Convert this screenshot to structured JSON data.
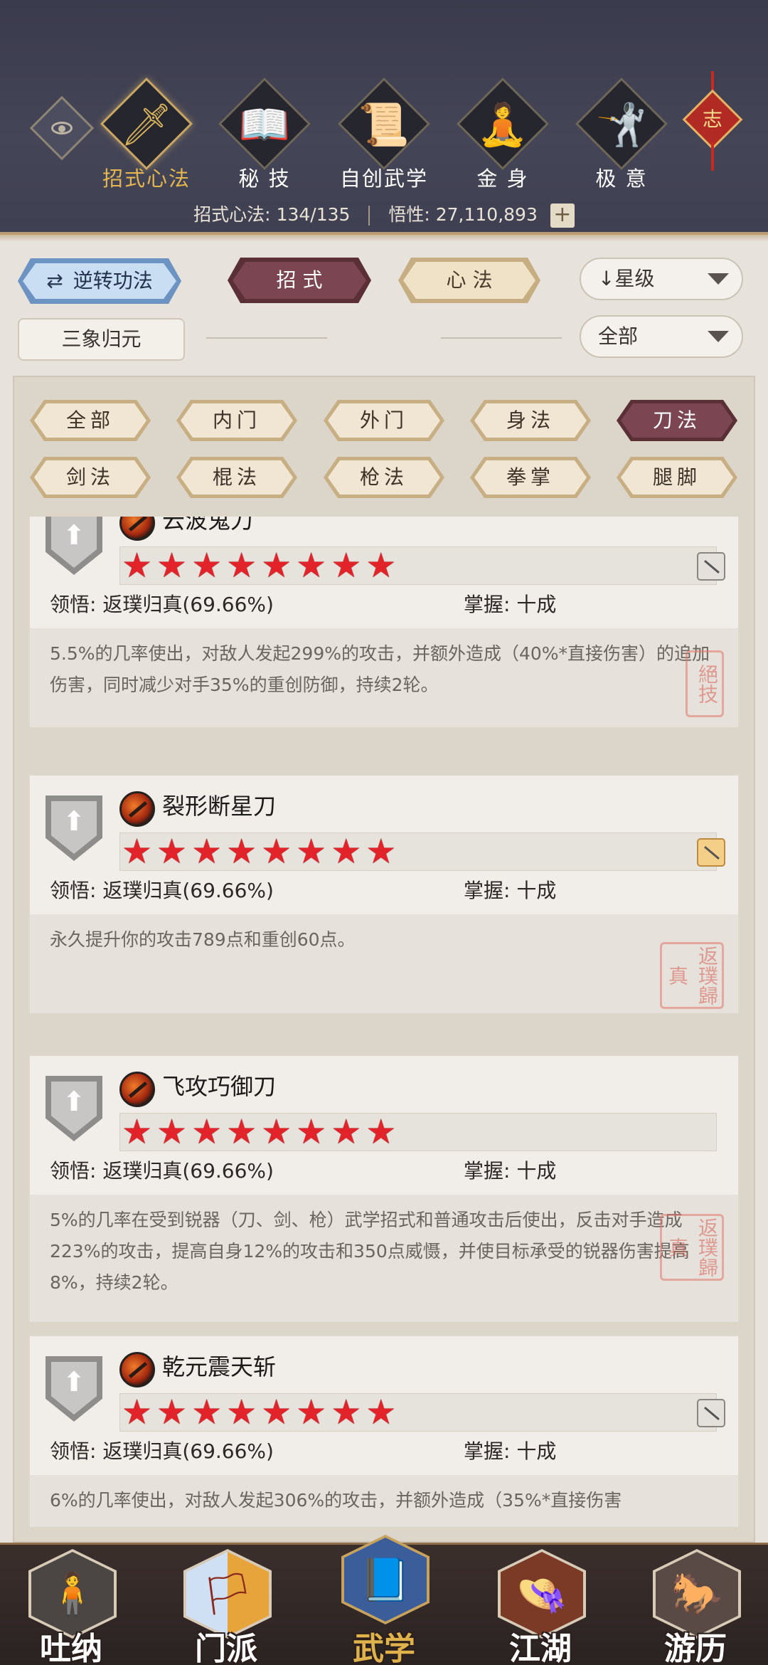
{
  "header": {
    "tabs": [
      {
        "label": "招式心法",
        "icon": "sword-icon",
        "glyph": "🗡"
      },
      {
        "label": "秘 技",
        "icon": "book-icon",
        "glyph": "📖"
      },
      {
        "label": "自创武学",
        "icon": "scroll-icon",
        "glyph": "📜"
      },
      {
        "label": "金 身",
        "icon": "meditation-icon",
        "glyph": "🧘"
      },
      {
        "label": "极 意",
        "icon": "martial-stance-icon",
        "glyph": "🤺"
      }
    ],
    "knot_char": "志",
    "stats": {
      "skills_label": "招式心法:",
      "skills_value": "134/135",
      "insight_label": "悟性:",
      "insight_value": "27,110,893",
      "plus": "+"
    }
  },
  "controls": {
    "reverse_label": "逆转功法",
    "reverse_icon": "⇄",
    "tab_zhaoshi": "招 式",
    "tab_xinfa": "心 法",
    "sort_label": "↓星级",
    "filter_label": "全部",
    "sanxiang_label": "三象归元"
  },
  "categories": [
    "全部",
    "内门",
    "外门",
    "身法",
    "刀法",
    "剑法",
    "棍法",
    "枪法",
    "拳掌",
    "腿脚"
  ],
  "cards": [
    {
      "name": "云波鬼刀",
      "stars": "★★★★★★★★",
      "comprehension_label": "领悟:",
      "comprehension_value": "返璞归真(69.66%)",
      "mastery_label": "掌握:",
      "mastery_value": "十成",
      "desc": "5.5%的几率使出，对敌人发起299%的攻击，并额外造成（40%*直接伤害）的追加伤害，同时减少对手35%的重创防御，持续2轮。",
      "seal": "絕技"
    },
    {
      "name": "裂形断星刀",
      "stars": "★★★★★★★★",
      "comprehension_label": "领悟:",
      "comprehension_value": "返璞归真(69.66%)",
      "mastery_label": "掌握:",
      "mastery_value": "十成",
      "desc": "永久提升你的攻击789点和重创60点。",
      "seal": "返璞歸真"
    },
    {
      "name": "飞攻巧御刀",
      "stars": "★★★★★★★★",
      "comprehension_label": "领悟:",
      "comprehension_value": "返璞归真(69.66%)",
      "mastery_label": "掌握:",
      "mastery_value": "十成",
      "desc": "5%的几率在受到锐器（刀、剑、枪）武学招式和普通攻击后使出，反击对手造成223%的攻击，提高自身12%的攻击和350点威慑，并使目标承受的锐器伤害提高8%，持续2轮。",
      "seal": "返璞歸真"
    },
    {
      "name": "乾元震天斩",
      "stars": "★★★★★★★★",
      "comprehension_label": "领悟:",
      "comprehension_value": "返璞归真(69.66%)",
      "mastery_label": "掌握:",
      "mastery_value": "十成",
      "desc": "6%的几率使出，对敌人发起306%的攻击，并额外造成（35%*直接伤害",
      "seal": ""
    }
  ],
  "bottom_nav": [
    {
      "label": "吐纳",
      "icon": "meditating-figure-icon",
      "glyph": "🧍"
    },
    {
      "label": "门派",
      "icon": "sect-banner-icon",
      "glyph": "🏳"
    },
    {
      "label": "武学",
      "icon": "martial-manual-icon",
      "glyph": "📘"
    },
    {
      "label": "江湖",
      "icon": "bamboo-hat-icon",
      "glyph": "👒"
    },
    {
      "label": "游历",
      "icon": "horse-icon",
      "glyph": "🐎"
    }
  ],
  "colors": {
    "active_gold": "#e3b64f",
    "star_red": "#e3232a",
    "active_chip": "#7b4552",
    "reverse_blue": "#c9ddf3"
  }
}
